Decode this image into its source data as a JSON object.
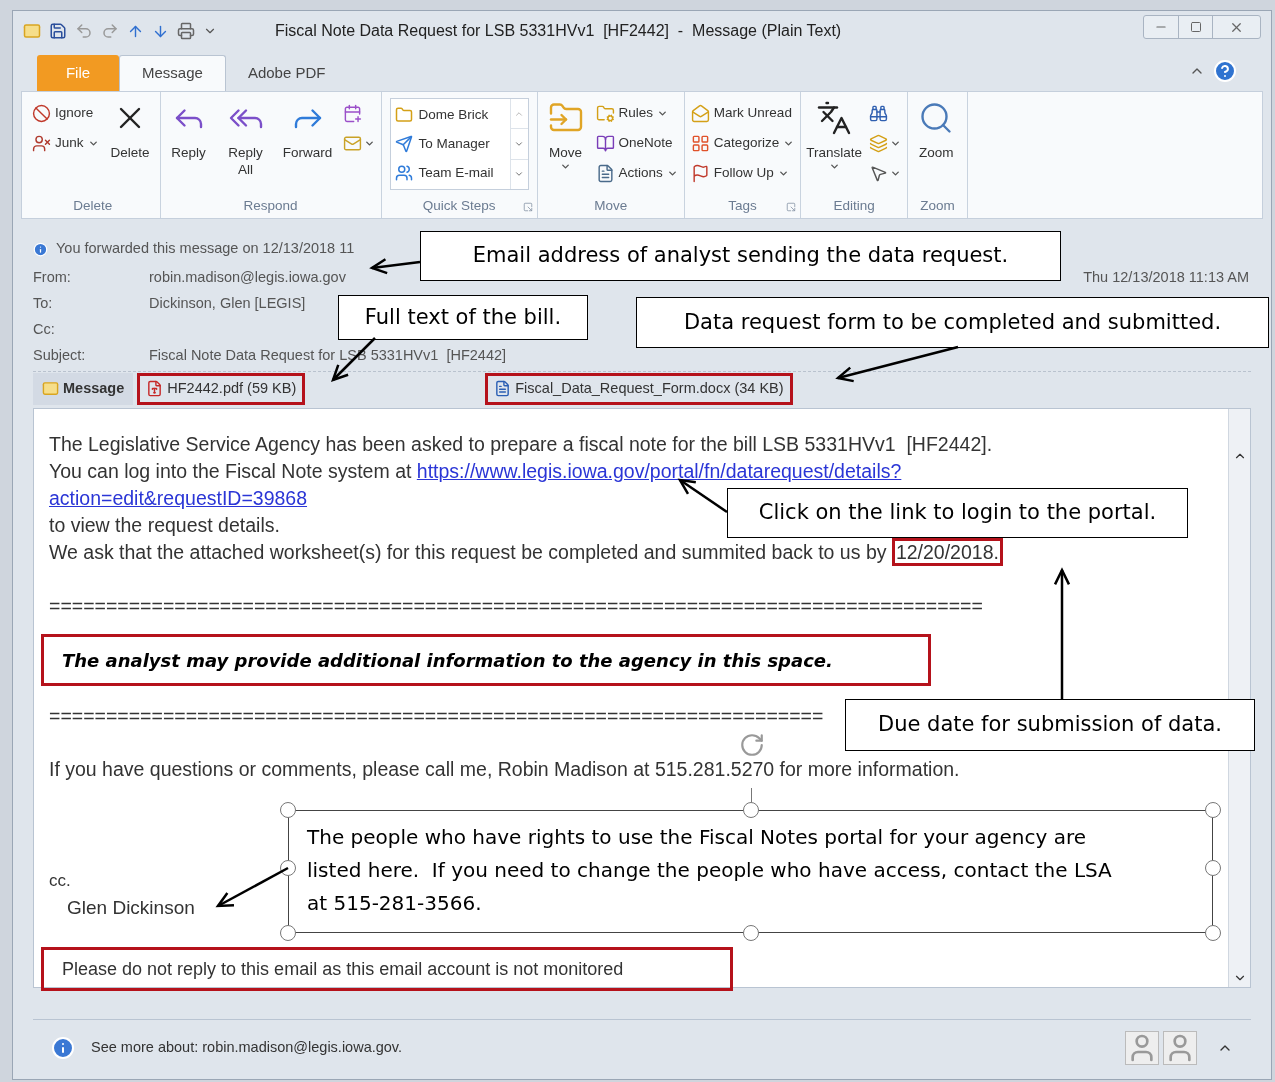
{
  "window": {
    "title": "Fiscal Note Data Request for LSB 5331HVv1  [HF2442]  -  Message (Plain Text)"
  },
  "tabs": [
    {
      "label": "File",
      "kind": "file",
      "selected": false
    },
    {
      "label": "Message",
      "kind": "tab",
      "selected": true
    },
    {
      "label": "Adobe PDF",
      "kind": "tab",
      "selected": false
    }
  ],
  "ribbon": [
    {
      "label": "Delete",
      "kind": "buttons",
      "launcher": false,
      "columns": [
        [
          {
            "kind": "small",
            "label": "Ignore",
            "dropdown": false
          },
          {
            "kind": "small",
            "label": "Junk",
            "dropdown": true
          }
        ],
        [
          {
            "kind": "large",
            "label": "Delete",
            "dropdown": false
          }
        ]
      ]
    },
    {
      "label": "Respond",
      "kind": "buttons",
      "launcher": false,
      "columns": [
        [
          {
            "kind": "large",
            "label": "Reply",
            "dropdown": false
          }
        ],
        [
          {
            "kind": "large",
            "label": "Reply All",
            "dropdown": false
          }
        ],
        [
          {
            "kind": "large",
            "label": "Forward",
            "dropdown": false
          }
        ],
        [
          {
            "kind": "icon",
            "dropdown": false
          },
          {
            "kind": "icon",
            "dropdown": true
          }
        ]
      ]
    },
    {
      "label": "Quick Steps",
      "kind": "gallery",
      "launcher": true,
      "items": [
        "Dome Brick",
        "To Manager",
        "Team E-mail"
      ]
    },
    {
      "label": "Move",
      "kind": "buttons",
      "launcher": false,
      "columns": [
        [
          {
            "kind": "large",
            "label": "Move",
            "dropdown": true
          }
        ],
        [
          {
            "kind": "small",
            "label": "Rules",
            "dropdown": true
          },
          {
            "kind": "small",
            "label": "OneNote",
            "dropdown": false
          },
          {
            "kind": "small",
            "label": "Actions",
            "dropdown": true
          }
        ]
      ]
    },
    {
      "label": "Tags",
      "kind": "buttons",
      "launcher": true,
      "columns": [
        [
          {
            "kind": "small",
            "label": "Mark Unread",
            "dropdown": false
          },
          {
            "kind": "small",
            "label": "Categorize",
            "dropdown": true
          },
          {
            "kind": "small",
            "label": "Follow Up",
            "dropdown": true
          }
        ]
      ]
    },
    {
      "label": "Editing",
      "kind": "buttons",
      "launcher": false,
      "columns": [
        [
          {
            "kind": "large",
            "label": "Translate",
            "dropdown": true
          }
        ],
        [
          {
            "kind": "icon",
            "dropdown": false
          },
          {
            "kind": "icon",
            "dropdown": true
          },
          {
            "kind": "icon",
            "dropdown": true
          }
        ]
      ]
    },
    {
      "label": "Zoom",
      "kind": "buttons",
      "launcher": false,
      "columns": [
        [
          {
            "kind": "large",
            "label": "Zoom",
            "dropdown": false
          }
        ]
      ]
    }
  ],
  "header": {
    "info": "You forwarded this message on 12/13/2018 11",
    "sent": "Thu 12/13/2018 11:13 AM",
    "fields": [
      {
        "label": "From:",
        "value": "robin.madison@legis.iowa.gov"
      },
      {
        "label": "To:",
        "value": "Dickinson, Glen [LEGIS]"
      },
      {
        "label": "Cc:"
      },
      {
        "label": "Subject:",
        "value": "Fiscal Note Data Request for LSB 5331HVv1  [HF2442]"
      }
    ],
    "attachments": [
      {
        "label": "Message",
        "kind": "message",
        "selected": true,
        "highlighted": false
      },
      {
        "label": "HF2442.pdf (59 KB)",
        "kind": "pdf",
        "selected": false,
        "highlighted": true
      },
      {
        "label": "Fiscal_Data_Request_Form.docx (34 KB)",
        "kind": "word",
        "selected": false,
        "highlighted": true
      }
    ]
  },
  "body": {
    "intro": "The Legislative Service Agency has been asked to prepare a fiscal note for the bill LSB 5331HVv1  [HF2442].",
    "login_text": "You can log into the Fiscal Note system at",
    "link_lines": [
      "https://www.legis.iowa.gov/portal/fn/datarequest/details?",
      "action=edit&requestID=39868"
    ],
    "view_text": "to view the request details.",
    "due_text": "We ask that the attached worksheet(s) for this request be completed and summited back to us by",
    "due_date": {
      "text": "12/20/2018.",
      "highlighted": true
    },
    "separators": [
      "==================================================================================",
      "===================================================================="
    ],
    "note": {
      "text": "The analyst may provide additional information to the agency in this space.",
      "highlighted": true
    },
    "contact": "If you have questions or comments, please call me, Robin Madison at 515.281.5270 for more information.",
    "cc_label": "cc.",
    "cc_name": "Glen Dickinson",
    "footer_note": {
      "text": "Please do not reply to this email as this email account is not monitored",
      "highlighted": true
    }
  },
  "callouts": [
    {
      "kind": "callout",
      "text": "Email address of analyst sending the data request."
    },
    {
      "kind": "callout",
      "text": "Full text of the bill."
    },
    {
      "kind": "callout",
      "text": "Data request form to be completed and submitted."
    },
    {
      "kind": "callout",
      "text": "Click on the link to login to the portal."
    },
    {
      "kind": "callout",
      "text": "Due date for submission of data."
    },
    {
      "kind": "textbox",
      "text": "The people who have rights to use the Fiscal Notes portal for your agency are listed here.  If you need to change the people who have access, contact the LSA at 515-281-3566."
    }
  ],
  "people_pane": {
    "text": "See more about: robin.madison@legis.iowa.gov."
  }
}
